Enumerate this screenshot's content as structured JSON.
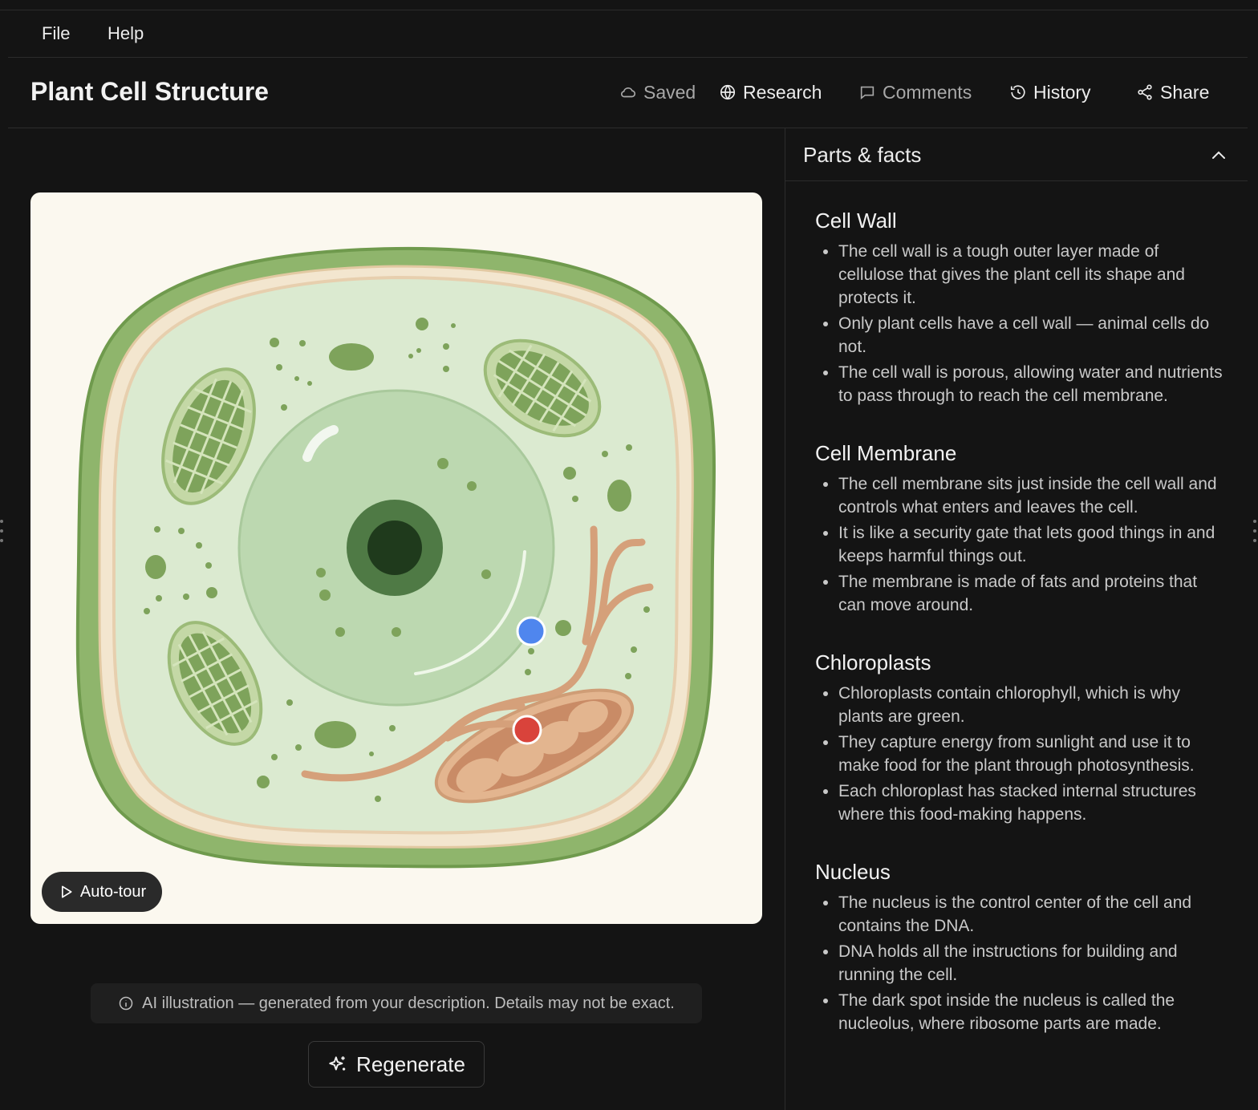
{
  "menu": {
    "file": "File",
    "help": "Help"
  },
  "header": {
    "title": "Plant Cell Structure",
    "saved": "Saved",
    "research": "Research",
    "comments": "Comments",
    "history": "History",
    "share": "Share"
  },
  "illustration": {
    "autotour_label": "Auto-tour"
  },
  "notice": "AI illustration — generated from your description. Details may not be exact.",
  "regenerate_label": "Regenerate",
  "panel": {
    "title": "Parts & facts",
    "sections": [
      {
        "title": "Cell Wall",
        "bullets": [
          "The cell wall is a tough outer layer made of cellulose that gives the plant cell its shape and protects it.",
          "Only plant cells have a cell wall — animal cells do not.",
          "The cell wall is porous, allowing water and nutrients to pass through to reach the cell membrane."
        ]
      },
      {
        "title": "Cell Membrane",
        "bullets": [
          "The cell membrane sits just inside the cell wall and controls what enters and leaves the cell.",
          "It is like a security gate that lets good things in and keeps harmful things out.",
          "The membrane is made of fats and proteins that can move around."
        ]
      },
      {
        "title": "Chloroplasts",
        "bullets": [
          "Chloroplasts contain chlorophyll, which is why plants are green.",
          "They capture energy from sunlight and use it to make food for the plant through photosynthesis.",
          "Each chloroplast has stacked internal structures where this food-making happens."
        ]
      },
      {
        "title": "Nucleus",
        "bullets": [
          "The nucleus is the control center of the cell and contains the DNA.",
          "DNA holds all the instructions for building and running the cell.",
          "The dark spot inside the nucleus is called the nucleolus, where ribosome parts are made."
        ]
      }
    ]
  },
  "colors": {
    "background": "#141414",
    "wall": "#8fb56c",
    "cytoplasm": "#dbead0",
    "nucleus": "#bcd8b0",
    "hotspot_blue": "#4f86ee",
    "hotspot_red": "#d9433b"
  }
}
